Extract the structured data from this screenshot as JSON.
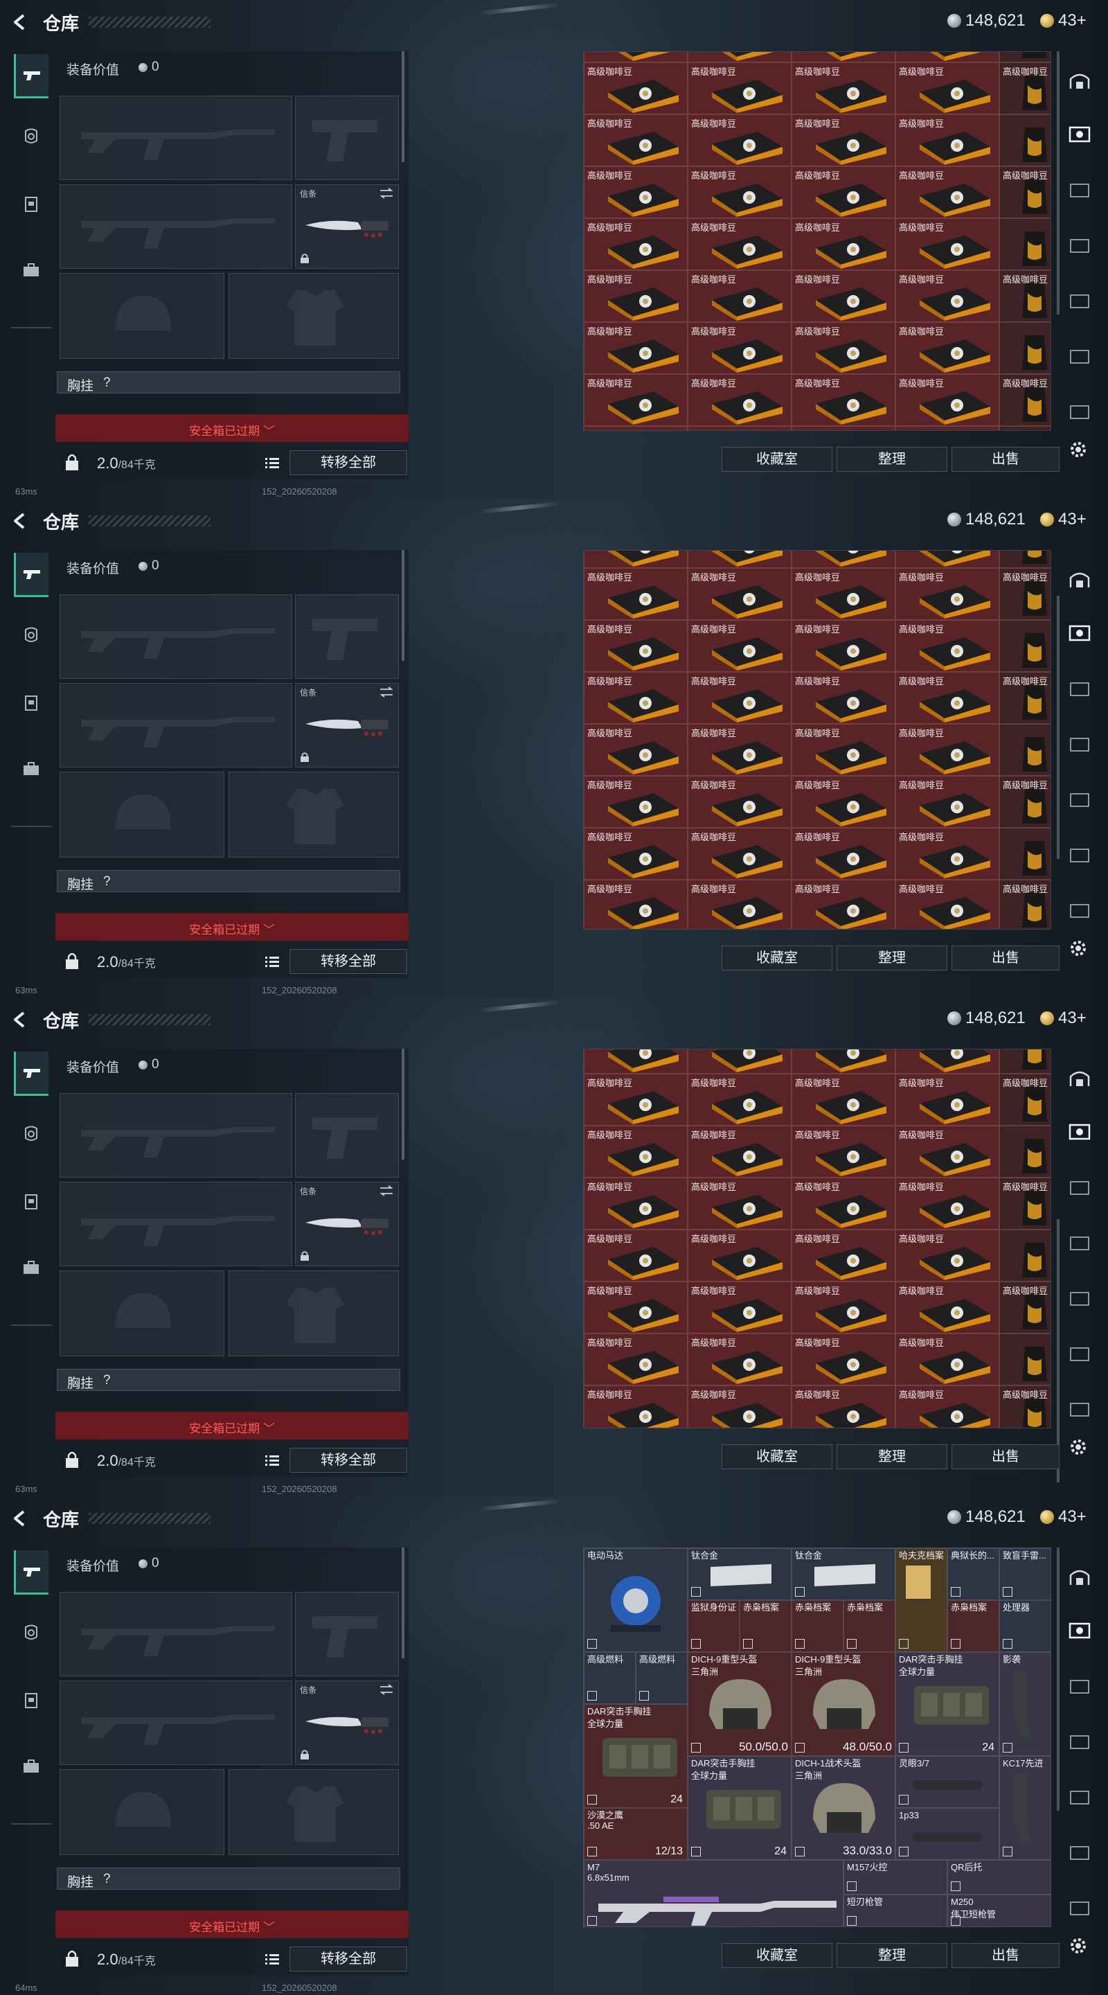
{
  "header": {
    "title": "仓库",
    "currency_silver": "148,621",
    "currency_gold": "43+"
  },
  "equipment": {
    "value_label": "装备价值",
    "value": "0",
    "melee_slot_label": "信条",
    "chest_rig_label": "胸挂",
    "chest_rig_help": "?",
    "safebox_status": "安全箱已过期",
    "weight": "2.0",
    "weight_unit": "/84千克",
    "transfer_all": "转移全部"
  },
  "status_bar": [
    {
      "ping": "63ms",
      "build": "152_20260520208"
    },
    {
      "ping": "63ms",
      "build": "152_20260520208"
    },
    {
      "ping": "63ms",
      "build": "152_20260520208"
    },
    {
      "ping": "64ms",
      "build": "152_20260520208"
    }
  ],
  "stash": {
    "item_label": "高级咖啡豆",
    "actions": [
      "收藏室",
      "整理",
      "出售"
    ]
  },
  "mixed_items": [
    {
      "name": "电动马达",
      "sub": ""
    },
    {
      "name": "钛合金",
      "sub": ""
    },
    {
      "name": "钛合金",
      "sub": ""
    },
    {
      "name": "哈夫克档案",
      "sub": ""
    },
    {
      "name": "典狱长的...",
      "sub": ""
    },
    {
      "name": "致盲手雷...",
      "sub": ""
    },
    {
      "name": "监狱身份证",
      "sub": ""
    },
    {
      "name": "赤枭档案",
      "sub": ""
    },
    {
      "name": "赤枭档案",
      "sub": ""
    },
    {
      "name": "赤枭档案",
      "sub": ""
    },
    {
      "name": "赤枭档案",
      "sub": ""
    },
    {
      "name": "赤枭档案",
      "sub": ""
    },
    {
      "name": "处理器",
      "sub": ""
    },
    {
      "name": "高级燃料",
      "sub": ""
    },
    {
      "name": "高级燃料",
      "sub": ""
    },
    {
      "name": "DICH-9重型头盔",
      "sub": "三角洲",
      "value": "50.0/50.0"
    },
    {
      "name": "DICH-9重型头盔",
      "sub": "三角洲",
      "value": "48.0/50.0"
    },
    {
      "name": "DAR突击手胸挂",
      "sub": "全球力量",
      "count": "24"
    },
    {
      "name": "影袭",
      "sub": ""
    },
    {
      "name": "DAR突击手胸挂",
      "sub": "全球力量",
      "count": "24"
    },
    {
      "name": "DAR突击手胸挂",
      "sub": "全球力量",
      "count": "24"
    },
    {
      "name": "DICH-1战术头盔",
      "sub": "三角洲",
      "value": "33.0/33.0"
    },
    {
      "name": "灵眼3/7",
      "sub": ""
    },
    {
      "name": "KC17先进",
      "sub": ""
    },
    {
      "name": "1p33",
      "sub": ""
    },
    {
      "name": "沙漠之鹰",
      "sub": ".50 AE",
      "count": "12/13"
    },
    {
      "name": "M7",
      "sub": "6.8x51mm"
    },
    {
      "name": "M157火控",
      "sub": ""
    },
    {
      "name": "QR后托",
      "sub": ""
    },
    {
      "name": "短刃枪管",
      "sub": ""
    },
    {
      "name": "M250",
      "sub": "伟卫短枪管"
    }
  ],
  "colors": {
    "accent_green": "#37c28a",
    "safebox_red": "#ff5a5a",
    "coffee_cell": "#5a2328"
  }
}
